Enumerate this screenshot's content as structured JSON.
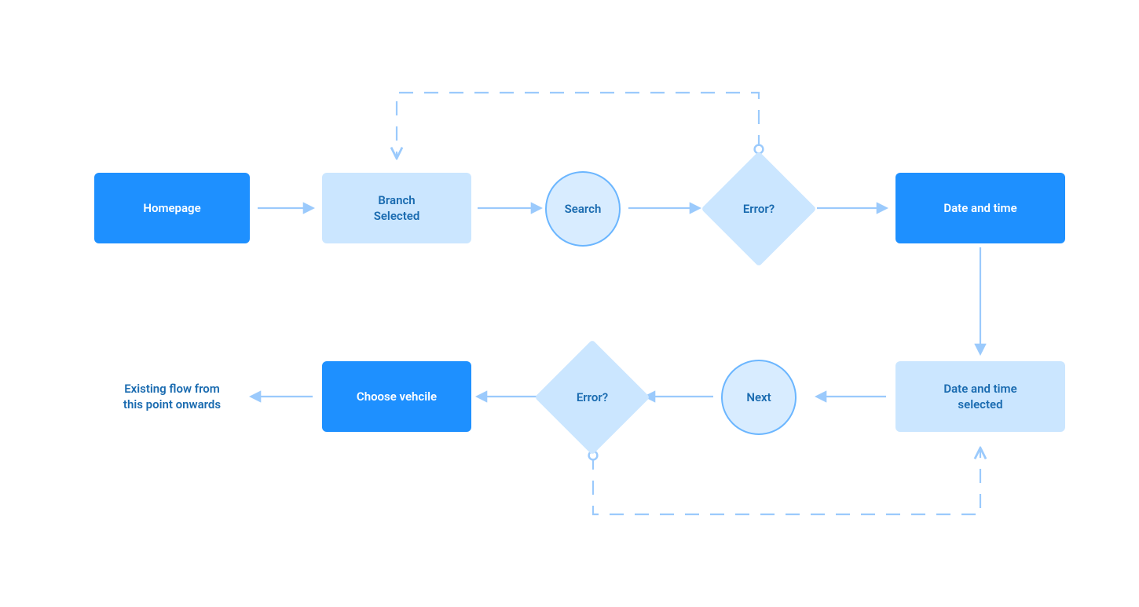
{
  "colors": {
    "solid_fill": "#1e90ff",
    "light_fill": "#cbe6ff",
    "stroke": "#9bcafc",
    "text_dark": "#1a6bb0",
    "text_light": "#ffffff"
  },
  "nodes": {
    "homepage": {
      "label": "Homepage",
      "type": "rect-solid"
    },
    "branch_selected": {
      "label": "Branch\nSelected",
      "type": "rect-light"
    },
    "search": {
      "label": "Search",
      "type": "circle"
    },
    "error1": {
      "label": "Error?",
      "type": "diamond"
    },
    "date_time": {
      "label": "Date and time",
      "type": "rect-solid"
    },
    "date_time_selected": {
      "label": "Date and time\nselected",
      "type": "rect-light"
    },
    "next": {
      "label": "Next",
      "type": "circle"
    },
    "error2": {
      "label": "Error?",
      "type": "diamond"
    },
    "choose_vehicle": {
      "label": "Choose vehcile",
      "type": "rect-solid"
    },
    "existing_flow": {
      "label": "Existing flow from\nthis point onwards",
      "type": "text"
    }
  },
  "edges": [
    {
      "from": "homepage",
      "to": "branch_selected",
      "style": "arrow"
    },
    {
      "from": "branch_selected",
      "to": "search",
      "style": "arrow"
    },
    {
      "from": "search",
      "to": "error1",
      "style": "arrow"
    },
    {
      "from": "error1",
      "to": "date_time",
      "style": "arrow"
    },
    {
      "from": "error1",
      "to": "branch_selected",
      "style": "dashed-loopback"
    },
    {
      "from": "date_time",
      "to": "date_time_selected",
      "style": "arrow"
    },
    {
      "from": "date_time_selected",
      "to": "next",
      "style": "arrow"
    },
    {
      "from": "next",
      "to": "error2",
      "style": "arrow"
    },
    {
      "from": "error2",
      "to": "choose_vehicle",
      "style": "arrow"
    },
    {
      "from": "error2",
      "to": "date_time_selected",
      "style": "dashed-loopback"
    },
    {
      "from": "choose_vehicle",
      "to": "existing_flow",
      "style": "arrow"
    }
  ]
}
